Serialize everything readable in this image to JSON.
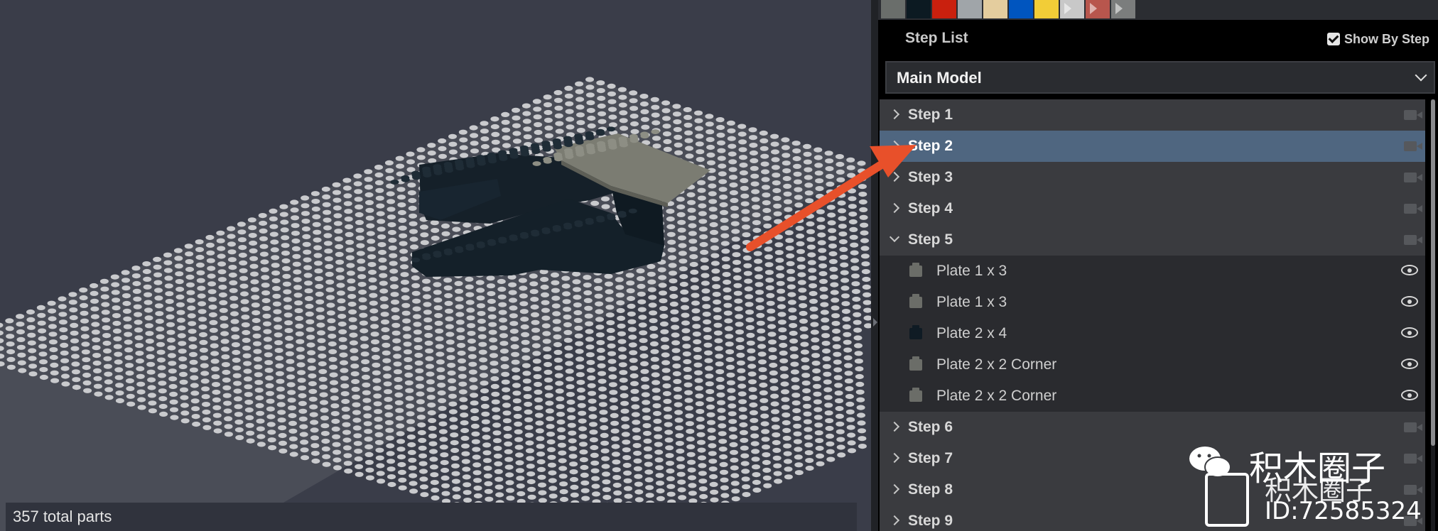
{
  "viewport": {
    "status_text": "357 total parts"
  },
  "palette": {
    "swatches": [
      {
        "name": "dark-bluish-gray",
        "color": "#6a6e6b"
      },
      {
        "name": "black",
        "color": "#0c1a22"
      },
      {
        "name": "red",
        "color": "#c9200e"
      },
      {
        "name": "light-bluish-gray",
        "color": "#a0a5a9"
      },
      {
        "name": "tan",
        "color": "#e4cd9e"
      },
      {
        "name": "blue",
        "color": "#0055bf"
      },
      {
        "name": "yellow",
        "color": "#f2cd37"
      },
      {
        "name": "trans-clear",
        "color": "#c8c8c8"
      },
      {
        "name": "trans-red",
        "color": "#b8564d"
      },
      {
        "name": "dark-gray-trans",
        "color": "#7b7d7d"
      }
    ]
  },
  "step_list": {
    "title": "Step List",
    "show_by_step_label": "Show By Step",
    "show_by_step_checked": true,
    "model_select": "Main Model",
    "rows": [
      {
        "kind": "step",
        "label": "Step 1",
        "selected": false,
        "expanded": false
      },
      {
        "kind": "step",
        "label": "Step 2",
        "selected": true,
        "expanded": false
      },
      {
        "kind": "step",
        "label": "Step 3",
        "selected": false,
        "expanded": false
      },
      {
        "kind": "step",
        "label": "Step 4",
        "selected": false,
        "expanded": false
      },
      {
        "kind": "step",
        "label": "Step 5",
        "selected": false,
        "expanded": true
      },
      {
        "kind": "part",
        "label": "Plate 1 x 3",
        "color": "#6b6d68"
      },
      {
        "kind": "part",
        "label": "Plate 1 x 3",
        "color": "#6b6d68"
      },
      {
        "kind": "part",
        "label": "Plate 2 x 4",
        "color": "#0f1b24"
      },
      {
        "kind": "part",
        "label": "Plate 2 x 2 Corner",
        "color": "#6b6d68"
      },
      {
        "kind": "part",
        "label": "Plate 2 x 2 Corner",
        "color": "#6b6d68"
      },
      {
        "kind": "step",
        "label": "Step 6",
        "selected": false,
        "expanded": false
      },
      {
        "kind": "step",
        "label": "Step 7",
        "selected": false,
        "expanded": false
      },
      {
        "kind": "step",
        "label": "Step 8",
        "selected": false,
        "expanded": false
      },
      {
        "kind": "step",
        "label": "Step 9",
        "selected": false,
        "expanded": false
      }
    ]
  },
  "watermark": {
    "line1": "积木圈子",
    "line2": "积木圈子",
    "id": "ID:72585324"
  },
  "annotation": {
    "arrow_color": "#e8502a"
  }
}
